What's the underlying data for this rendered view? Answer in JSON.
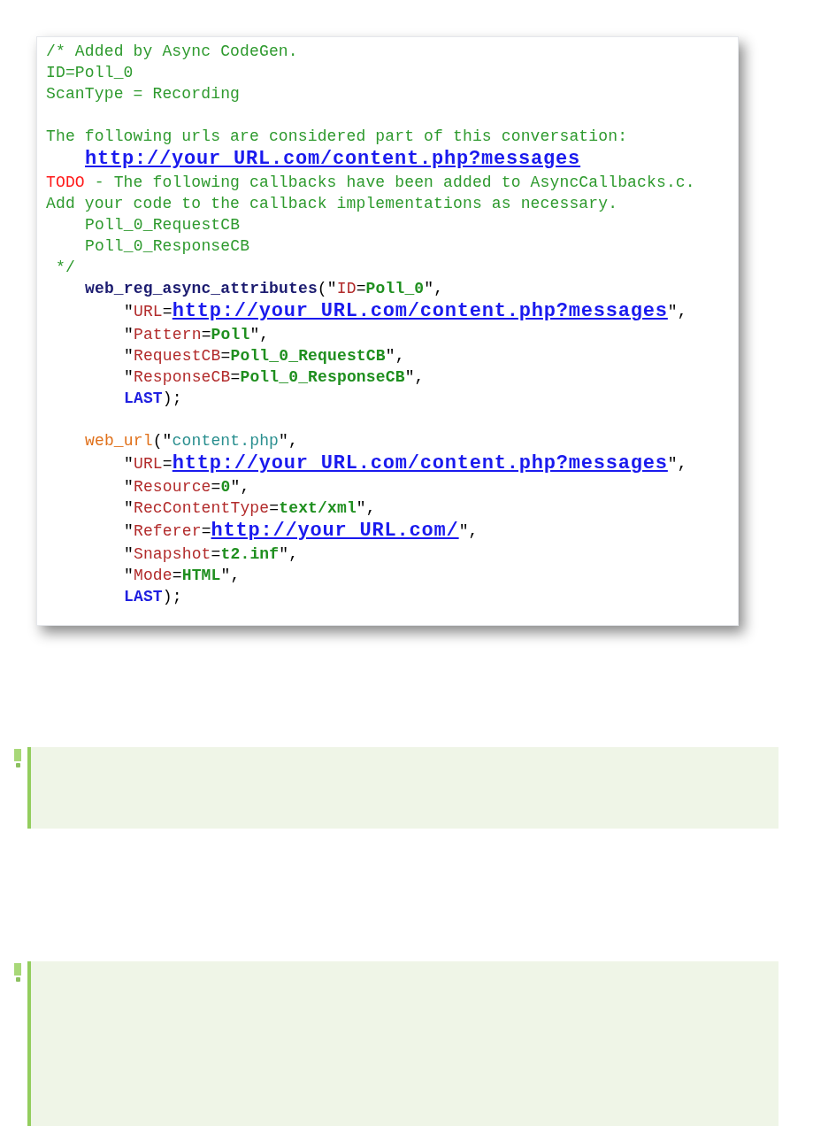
{
  "code_lines": [
    {
      "kind": "code",
      "tokens": [
        {
          "kind": "comment",
          "text": "/* Added by Async CodeGen."
        }
      ]
    },
    {
      "kind": "code",
      "tokens": [
        {
          "kind": "comment",
          "text": "ID=Poll_0"
        }
      ]
    },
    {
      "kind": "code",
      "tokens": [
        {
          "kind": "comment",
          "text": "ScanType = Recording"
        }
      ]
    },
    {
      "kind": "blank"
    },
    {
      "kind": "code",
      "tokens": [
        {
          "kind": "comment",
          "text": "The following urls are considered part of this conversation:"
        }
      ]
    },
    {
      "kind": "indented",
      "tokens": [
        {
          "kind": "link",
          "text": "http://your URL.com/content.php?messages"
        }
      ]
    },
    {
      "kind": "code",
      "tokens": [
        {
          "kind": "todo",
          "text": "TODO"
        },
        {
          "kind": "comment",
          "text": " - The following callbacks have been added to AsyncCallbacks.c."
        }
      ]
    },
    {
      "kind": "code",
      "tokens": [
        {
          "kind": "comment",
          "text": "Add your code to the callback implementations as necessary."
        }
      ]
    },
    {
      "kind": "indented",
      "tokens": [
        {
          "kind": "comment",
          "text": "Poll_0_RequestCB"
        }
      ]
    },
    {
      "kind": "indented",
      "tokens": [
        {
          "kind": "comment",
          "text": "Poll_0_ResponseCB"
        }
      ]
    },
    {
      "kind": "code",
      "tokens": [
        {
          "kind": "comment",
          "text": " */"
        }
      ]
    },
    {
      "kind": "indented",
      "tokens": [
        {
          "kind": "func",
          "text": "web_reg_async_attributes"
        },
        {
          "kind": "punct",
          "text": "(\""
        },
        {
          "kind": "key",
          "text": "ID"
        },
        {
          "kind": "punct",
          "text": "="
        },
        {
          "kind": "value",
          "text": "Poll_0"
        },
        {
          "kind": "punct",
          "text": "\","
        }
      ]
    },
    {
      "kind": "argument",
      "tokens": [
        {
          "kind": "punct",
          "text": "\""
        },
        {
          "kind": "key",
          "text": "URL"
        },
        {
          "kind": "punct",
          "text": "="
        },
        {
          "kind": "link",
          "text": "http://your URL.com/content.php?messages"
        },
        {
          "kind": "punct",
          "text": "\","
        }
      ]
    },
    {
      "kind": "argument",
      "tokens": [
        {
          "kind": "punct",
          "text": "\""
        },
        {
          "kind": "key",
          "text": "Pattern"
        },
        {
          "kind": "punct",
          "text": "="
        },
        {
          "kind": "value",
          "text": "Poll"
        },
        {
          "kind": "punct",
          "text": "\","
        }
      ]
    },
    {
      "kind": "argument",
      "tokens": [
        {
          "kind": "punct",
          "text": "\""
        },
        {
          "kind": "key",
          "text": "RequestCB"
        },
        {
          "kind": "punct",
          "text": "="
        },
        {
          "kind": "value",
          "text": "Poll_0_RequestCB"
        },
        {
          "kind": "punct",
          "text": "\","
        }
      ]
    },
    {
      "kind": "argument",
      "tokens": [
        {
          "kind": "punct",
          "text": "\""
        },
        {
          "kind": "key",
          "text": "ResponseCB"
        },
        {
          "kind": "punct",
          "text": "="
        },
        {
          "kind": "value",
          "text": "Poll_0_ResponseCB"
        },
        {
          "kind": "punct",
          "text": "\","
        }
      ]
    },
    {
      "kind": "argument",
      "tokens": [
        {
          "kind": "keyword",
          "text": "LAST"
        },
        {
          "kind": "punct",
          "text": ");"
        }
      ]
    },
    {
      "kind": "blank"
    },
    {
      "kind": "indented",
      "tokens": [
        {
          "kind": "func2",
          "text": "web_url"
        },
        {
          "kind": "punct",
          "text": "(\""
        },
        {
          "kind": "string",
          "text": "content.php"
        },
        {
          "kind": "punct",
          "text": "\","
        }
      ]
    },
    {
      "kind": "argument",
      "tokens": [
        {
          "kind": "punct",
          "text": "\""
        },
        {
          "kind": "key",
          "text": "URL"
        },
        {
          "kind": "punct",
          "text": "="
        },
        {
          "kind": "link",
          "text": "http://your URL.com/content.php?messages"
        },
        {
          "kind": "punct",
          "text": "\","
        }
      ]
    },
    {
      "kind": "argument",
      "tokens": [
        {
          "kind": "punct",
          "text": "\""
        },
        {
          "kind": "key",
          "text": "Resource"
        },
        {
          "kind": "punct",
          "text": "="
        },
        {
          "kind": "value",
          "text": "0"
        },
        {
          "kind": "punct",
          "text": "\","
        }
      ]
    },
    {
      "kind": "argument",
      "tokens": [
        {
          "kind": "punct",
          "text": "\""
        },
        {
          "kind": "key",
          "text": "RecContentType"
        },
        {
          "kind": "punct",
          "text": "="
        },
        {
          "kind": "value",
          "text": "text/xml"
        },
        {
          "kind": "punct",
          "text": "\","
        }
      ]
    },
    {
      "kind": "argument",
      "tokens": [
        {
          "kind": "punct",
          "text": "\""
        },
        {
          "kind": "key",
          "text": "Referer"
        },
        {
          "kind": "punct",
          "text": "="
        },
        {
          "kind": "link",
          "text": "http://your URL.com/"
        },
        {
          "kind": "punct",
          "text": "\","
        }
      ]
    },
    {
      "kind": "argument",
      "tokens": [
        {
          "kind": "punct",
          "text": "\""
        },
        {
          "kind": "key",
          "text": "Snapshot"
        },
        {
          "kind": "punct",
          "text": "="
        },
        {
          "kind": "value",
          "text": "t2.inf"
        },
        {
          "kind": "punct",
          "text": "\","
        }
      ]
    },
    {
      "kind": "argument",
      "tokens": [
        {
          "kind": "punct",
          "text": "\""
        },
        {
          "kind": "key",
          "text": "Mode"
        },
        {
          "kind": "punct",
          "text": "="
        },
        {
          "kind": "value",
          "text": "HTML"
        },
        {
          "kind": "punct",
          "text": "\","
        }
      ]
    },
    {
      "kind": "argument",
      "tokens": [
        {
          "kind": "keyword",
          "text": "LAST"
        },
        {
          "kind": "punct",
          "text": ");"
        }
      ]
    }
  ],
  "notes": [
    {
      "kind": "tip"
    },
    {
      "kind": "tip"
    }
  ]
}
